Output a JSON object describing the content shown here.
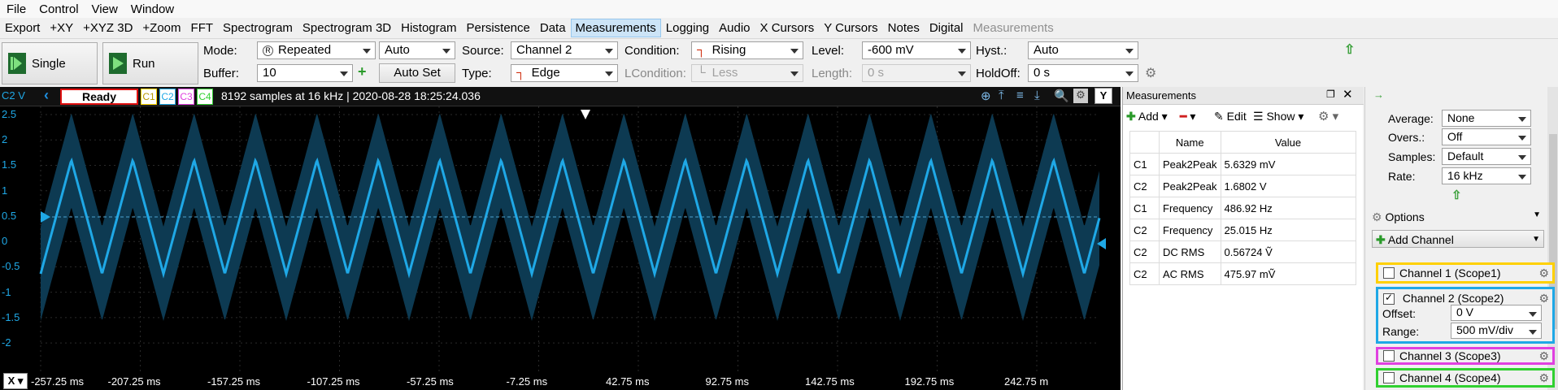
{
  "menu": [
    "File",
    "Control",
    "View",
    "Window"
  ],
  "toolbar": {
    "items": [
      "Export",
      "+XY",
      "+XYZ 3D",
      "+Zoom",
      "FFT",
      "Spectrogram",
      "Spectrogram 3D",
      "Histogram",
      "Persistence",
      "Data",
      "Measurements",
      "Logging",
      "Audio",
      "X Cursors",
      "Y Cursors",
      "Notes",
      "Digital",
      "Measurements"
    ],
    "active": "Measurements"
  },
  "controls": {
    "single": "Single",
    "run": "Run",
    "mode_label": "Mode:",
    "mode_value": "Repeated",
    "auto_value": "Auto",
    "buffer_label": "Buffer:",
    "buffer_value": "10",
    "autoset": "Auto Set",
    "source_label": "Source:",
    "source_value": "Channel 2",
    "type_label": "Type:",
    "type_value": "Edge",
    "condition_label": "Condition:",
    "condition_value": "Rising",
    "lcondition_label": "LCondition:",
    "lcondition_value": "Less",
    "level_label": "Level:",
    "level_value": "-600 mV",
    "length_label": "Length:",
    "length_value": "0 s",
    "hyst_label": "Hyst.:",
    "hyst_value": "Auto",
    "holdoff_label": "HoldOff:",
    "holdoff_value": "0 s"
  },
  "scope": {
    "channel_label": "C2 V",
    "status": "Ready",
    "channels": [
      "C1",
      "C2",
      "C3",
      "C4"
    ],
    "info": "8192 samples at 16 kHz | 2020-08-28 18:25:24.036",
    "y_ticks": [
      "2.5",
      "2",
      "1.5",
      "1",
      "0.5",
      "0",
      "-0.5",
      "-1",
      "-1.5",
      "-2"
    ],
    "x_ticks": [
      "-257.25 ms",
      "-207.25 ms",
      "-157.25 ms",
      "-107.25 ms",
      "-57.25 ms",
      "-7.25 ms",
      "42.75 ms",
      "92.75 ms",
      "142.75 ms",
      "192.75 ms",
      "242.75 m"
    ],
    "x_button": "X",
    "y_button": "Y",
    "colors": {
      "c1": "#ffd700",
      "c2": "#1fa8e6",
      "c3": "#e040e0",
      "c4": "#30d030"
    }
  },
  "measurements": {
    "title": "Measurements",
    "add": "Add",
    "edit": "Edit",
    "show": "Show",
    "col_name": "Name",
    "col_value": "Value",
    "rows": [
      {
        "ch": "C1",
        "name": "Peak2Peak",
        "value": "5.6329 mV"
      },
      {
        "ch": "C2",
        "name": "Peak2Peak",
        "value": "1.6802 V"
      },
      {
        "ch": "C1",
        "name": "Frequency",
        "value": "486.92 Hz"
      },
      {
        "ch": "C2",
        "name": "Frequency",
        "value": "25.015 Hz"
      },
      {
        "ch": "C2",
        "name": "DC RMS",
        "value": "0.56724 Ṽ"
      },
      {
        "ch": "C2",
        "name": "AC RMS",
        "value": "475.97 mṼ"
      }
    ]
  },
  "side": {
    "average_label": "Average:",
    "average_value": "None",
    "overs_label": "Overs.:",
    "overs_value": "Off",
    "samples_label": "Samples:",
    "samples_value": "Default",
    "rate_label": "Rate:",
    "rate_value": "16 kHz",
    "options": "Options",
    "add_channel": "Add Channel",
    "ch1": "Channel 1 (Scope1)",
    "ch2": "Channel 2 (Scope2)",
    "offset_label": "Offset:",
    "offset_value": "0 V",
    "range_label": "Range:",
    "range_value": "500 mV/div",
    "ch3": "Channel 3 (Scope3)",
    "ch4": "Channel 4 (Scope4)"
  }
}
